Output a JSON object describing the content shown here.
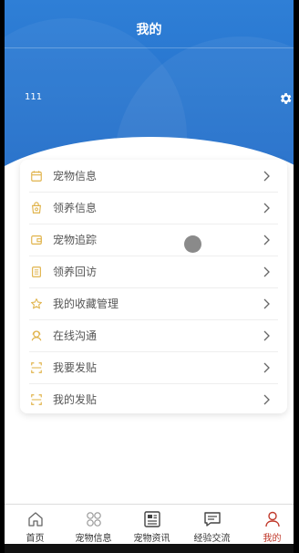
{
  "header": {
    "title": "我的",
    "username": "111"
  },
  "menu": [
    {
      "label": "宠物信息",
      "icon": "calendar-icon"
    },
    {
      "label": "领养信息",
      "icon": "pet-bag-icon"
    },
    {
      "label": "宠物追踪",
      "icon": "wallet-icon"
    },
    {
      "label": "领养回访",
      "icon": "document-icon"
    },
    {
      "label": "我的收藏管理",
      "icon": "star-icon"
    },
    {
      "label": "在线沟通",
      "icon": "chat-person-icon"
    },
    {
      "label": "我要发贴",
      "icon": "scan-icon"
    },
    {
      "label": "我的发贴",
      "icon": "scan-icon"
    }
  ],
  "tabs": [
    {
      "label": "首页",
      "icon": "home-icon"
    },
    {
      "label": "宠物信息",
      "icon": "grid-circles-icon"
    },
    {
      "label": "宠物资讯",
      "icon": "newspaper-icon"
    },
    {
      "label": "经验交流",
      "icon": "chat-icon"
    },
    {
      "label": "我的",
      "icon": "user-icon",
      "active": true
    }
  ],
  "colors": {
    "primary": "#1e6ac7",
    "icon_gold": "#e0b34a",
    "active_tab": "#c0392b"
  }
}
